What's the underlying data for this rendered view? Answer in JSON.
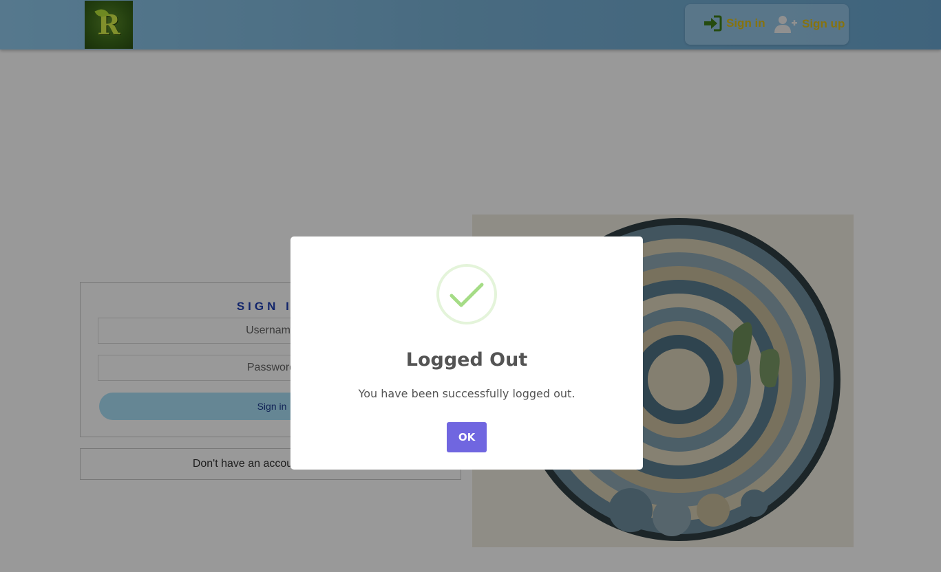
{
  "header": {
    "logo_letter": "R",
    "signin_label": "Sign in",
    "signup_label": "Sign up",
    "accent_color": "#e0c01a"
  },
  "login": {
    "title": "SIGN IN",
    "username_placeholder": "Username",
    "password_placeholder": "Password",
    "submit_label": "Sign in",
    "no_account_text": "Don't have an account? Sign up"
  },
  "modal": {
    "icon": "success-check-icon",
    "title": "Logged Out",
    "message": "You have been successfully logged out.",
    "ok_label": "OK",
    "button_color": "#7066e0",
    "check_color": "#a5dc86"
  }
}
